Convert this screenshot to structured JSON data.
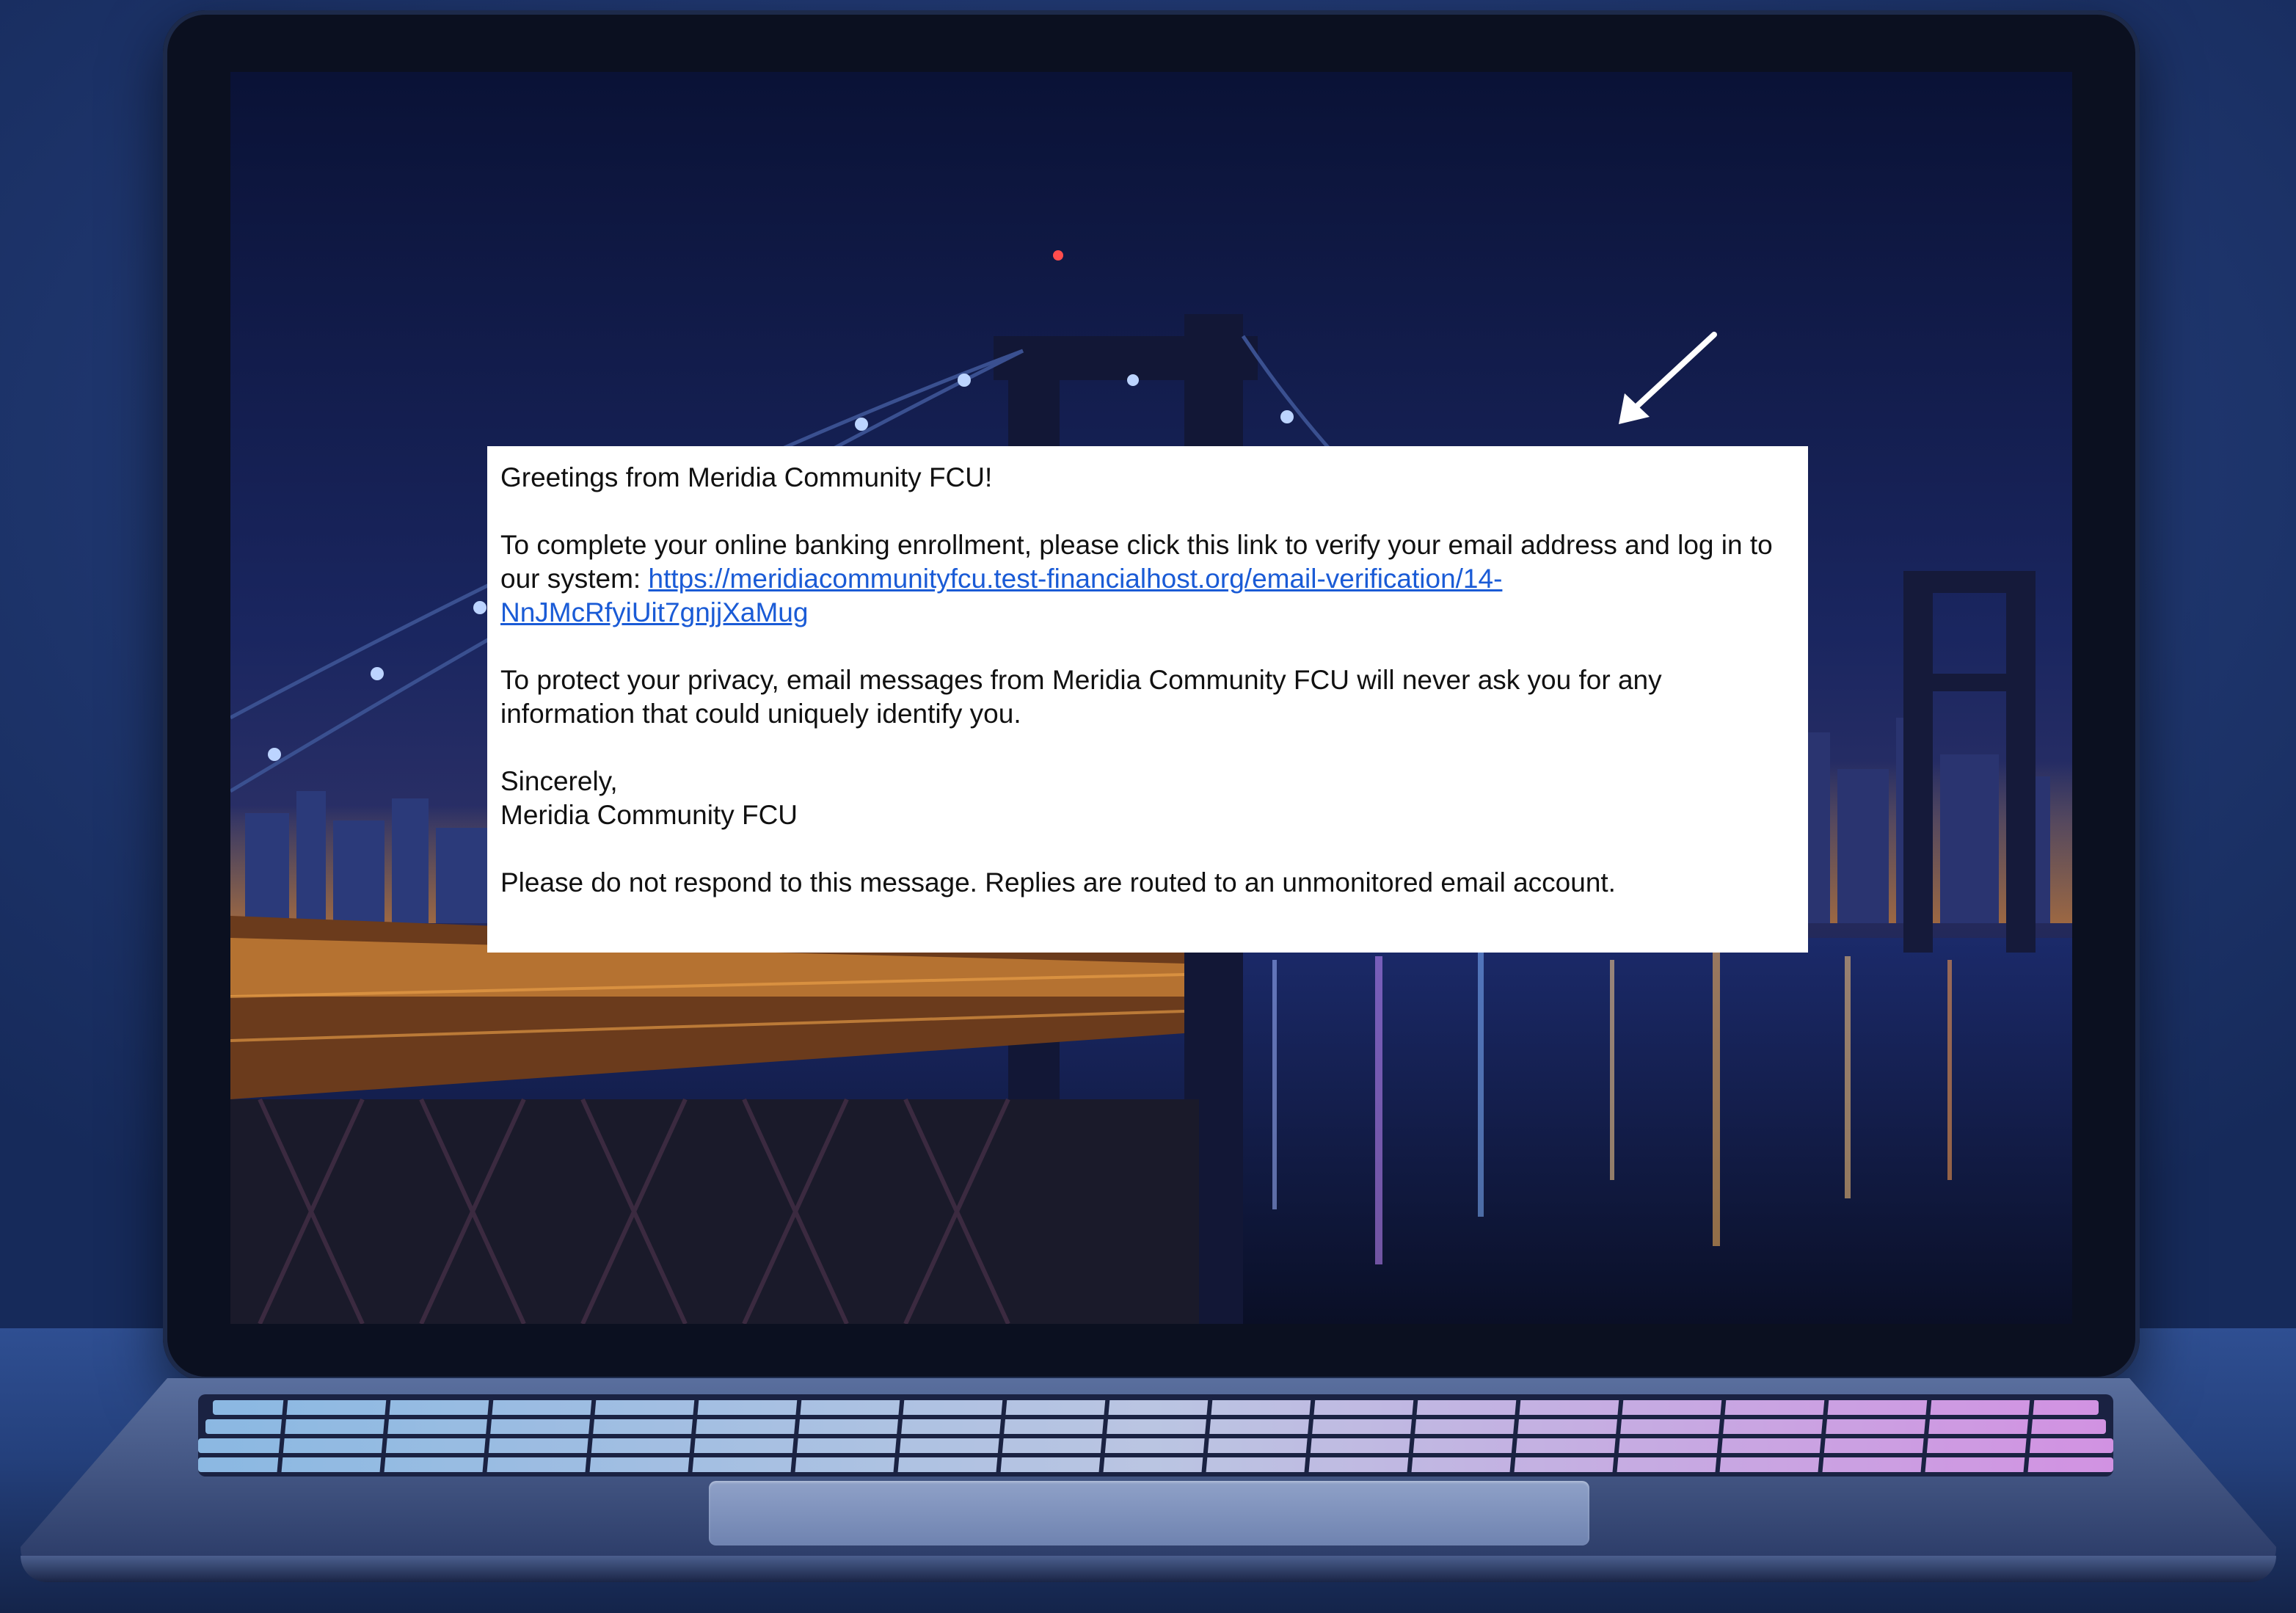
{
  "email": {
    "greeting": "Greetings from Meridia Community FCU!",
    "body_intro": "To complete your online banking enrollment, please click this link to verify your email address and log in to our system: ",
    "verification_link": "https://meridiacommunityfcu.test-financialhost.org/email-verification/14-NnJMcRfyiUit7gnjjXaMug",
    "privacy_notice": "To protect your privacy, email messages from Meridia Community FCU will never ask you for any information that could uniquely identify you.",
    "closing": "Sincerely,",
    "signature": "Meridia Community FCU",
    "footer_notice": "Please do not respond to this message. Replies are routed to an unmonitored email account."
  },
  "colors": {
    "link": "#1a5bd6",
    "panel_background": "#ffffff",
    "arrow": "#ffffff",
    "keyboard_glow_left": "#9fd3ff",
    "keyboard_glow_right": "#f2a6ff"
  },
  "icons": {
    "arrow": "arrow-pointer-icon"
  }
}
